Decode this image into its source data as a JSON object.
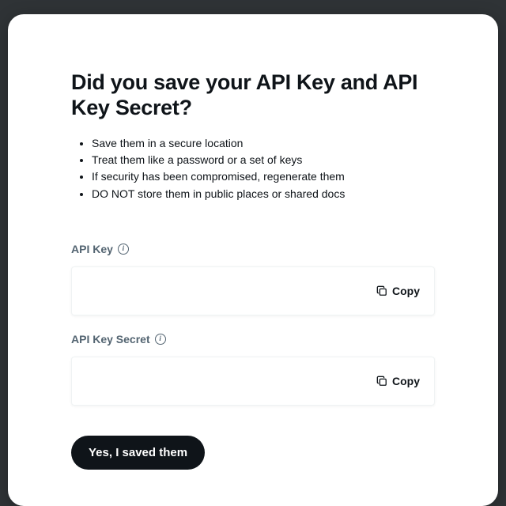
{
  "modal": {
    "title": "Did you save your API Key and API Key Secret?",
    "bullets": [
      "Save them in a secure location",
      "Treat them like a password or a set of keys",
      "If security has been compromised, regenerate them",
      "DO NOT store them in public places or shared docs"
    ],
    "fields": {
      "api_key": {
        "label": "API Key",
        "copy_label": "Copy"
      },
      "api_key_secret": {
        "label": "API Key Secret",
        "copy_label": "Copy"
      }
    },
    "confirm_label": "Yes, I saved them"
  }
}
